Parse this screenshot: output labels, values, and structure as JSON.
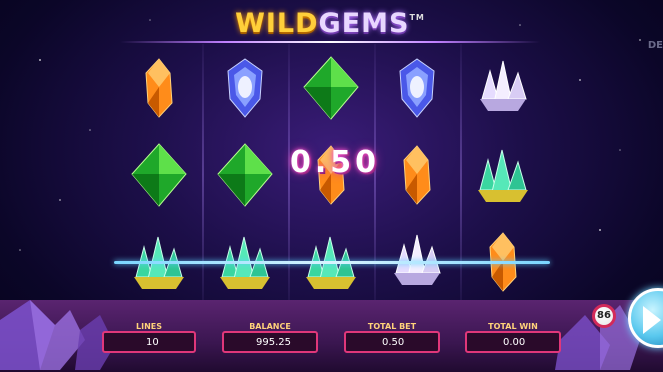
{
  "game": {
    "logo_wild": "WILD",
    "logo_gems": "GEMS",
    "logo_tm": "TM",
    "side_text": "DE"
  },
  "win_display": {
    "amount": "0.50"
  },
  "reels": [
    [
      "orange-gem",
      "green-gem",
      "green-crystal-cluster"
    ],
    [
      "blue-gem",
      "green-gem",
      "green-crystal-cluster"
    ],
    [
      "green-gem",
      "orange-gem",
      "green-crystal-cluster"
    ],
    [
      "blue-gem",
      "orange-gem",
      "white-crystal-cluster"
    ],
    [
      "white-crystal-cluster",
      "green-crystal-cluster",
      "orange-gem"
    ]
  ],
  "badge": {
    "value": "86"
  },
  "hud": {
    "lines_label": "LINES",
    "lines_value": "10",
    "balance_label": "BALANCE",
    "balance_value": "995.25",
    "total_bet_label": "TOTAL BET",
    "total_bet_value": "0.50",
    "total_win_label": "TOTAL WIN",
    "total_win_value": "0.00"
  },
  "colors": {
    "accent_pink": "#e0377a",
    "label_gold": "#ffd27a",
    "spin_blue": "#59c8ee"
  }
}
